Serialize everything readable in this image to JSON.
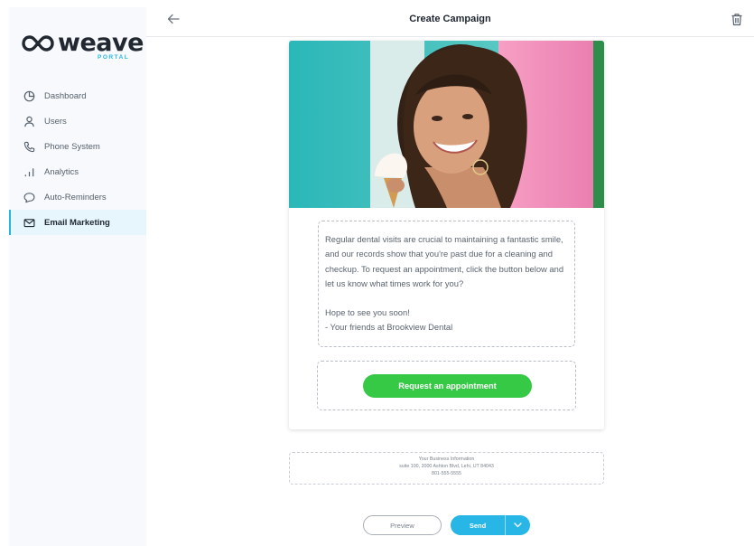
{
  "brand": {
    "logo_icon": "weave-infinity-logo",
    "name": "weave",
    "sub": "PORTAL",
    "accent": "#27b6e6"
  },
  "sidebar": {
    "items": [
      {
        "label": "Dashboard",
        "icon": "pie-chart-icon",
        "active": false
      },
      {
        "label": "Users",
        "icon": "user-icon",
        "active": false
      },
      {
        "label": "Phone System",
        "icon": "phone-icon",
        "active": false
      },
      {
        "label": "Analytics",
        "icon": "bar-chart-icon",
        "active": false
      },
      {
        "label": "Auto-Reminders",
        "icon": "chat-bubble-icon",
        "active": false
      },
      {
        "label": "Email Marketing",
        "icon": "envelope-icon",
        "active": true
      }
    ]
  },
  "header": {
    "back_icon": "arrow-left-icon",
    "title": "Create Campaign",
    "delete_icon": "trash-icon"
  },
  "email": {
    "hero_image": "smiling-woman-with-ice-cream-photo",
    "body_paragraph": "Regular dental visits are crucial to maintaining a fantastic smile, and our records show that you're past due for a cleaning and checkup. To request an appointment, click the button below and let us know what times work for you?",
    "signoff_line1": "Hope to see you soon!",
    "signoff_line2": "- Your friends at Brookview Dental",
    "cta_label": "Request an appointment",
    "cta_color": "#35c945"
  },
  "business_info": {
    "title": "Your Business Information",
    "address": "suite 100, 2000 Ashton Blvd, Lehi, UT 84043",
    "phone": "801-555-5555"
  },
  "actions": {
    "preview_label": "Preview",
    "send_label": "Send",
    "send_menu_icon": "chevron-down-icon"
  }
}
